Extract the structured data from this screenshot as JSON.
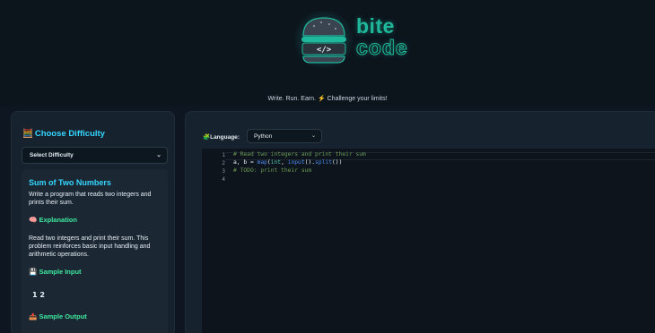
{
  "brand": {
    "word1": "bite",
    "word2": "code",
    "tagline": "Write. Run. Earn. ⚡ Challenge your limits!",
    "accent": "#1fb89c"
  },
  "sidebar": {
    "title": "Choose Difficulty",
    "title_icon": "abacus-icon",
    "difficulty_select": {
      "value": "Select Difficulty"
    },
    "problem": {
      "title": "Sum of Two Numbers",
      "description": "Write a program that reads two integers and prints their sum.",
      "explanation_heading": "Explanation",
      "explanation": "Read two integers and print their sum. This problem reinforces basic input handling and arithmetic operations.",
      "sample_input_heading": "Sample Input",
      "sample_input": "1 2",
      "sample_output_heading": "Sample Output"
    }
  },
  "main": {
    "language_label": "Language:",
    "language_value": "Python",
    "code_lines": [
      {
        "n": "1",
        "text": "# Read two integers and print their sum"
      },
      {
        "n": "2",
        "text": "a, b = map(int, input().split())"
      },
      {
        "n": "3",
        "text": "# TODO: print their sum"
      },
      {
        "n": "4",
        "text": ""
      }
    ]
  },
  "colors": {
    "heading": "#35d6ff",
    "section": "#3ee89e",
    "background": "#0e1621",
    "panel": "#16222e"
  }
}
